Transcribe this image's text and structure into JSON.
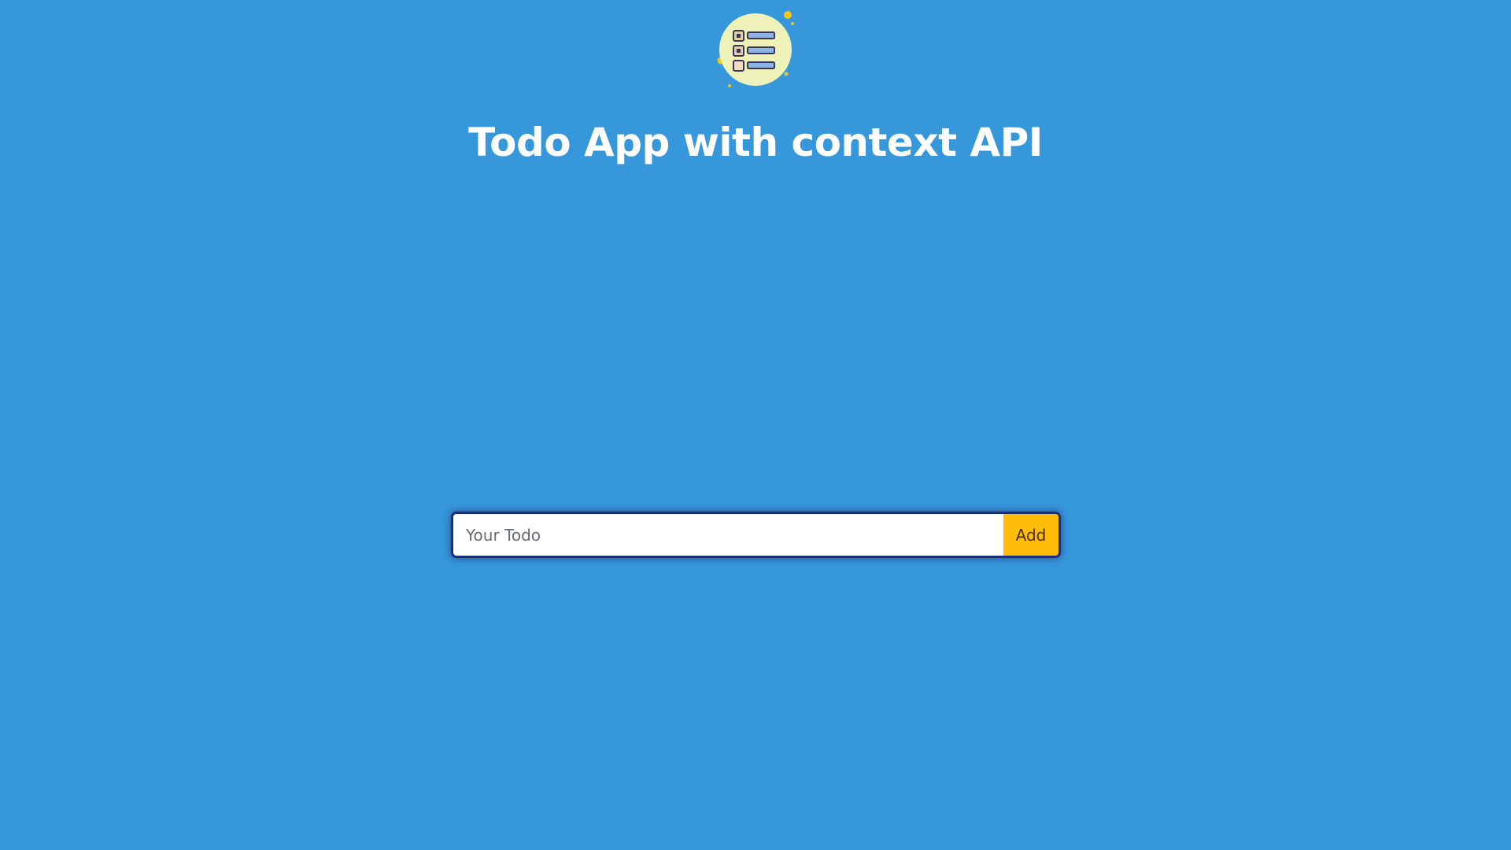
{
  "header": {
    "title": "Todo App with context API",
    "logo_icon": "checklist-icon"
  },
  "todo_form": {
    "input_placeholder": "Your Todo",
    "input_value": "",
    "add_label": "Add"
  },
  "colors": {
    "background": "#3797db",
    "accent": "#ffbd0a",
    "form_border": "#1e3a8a"
  }
}
